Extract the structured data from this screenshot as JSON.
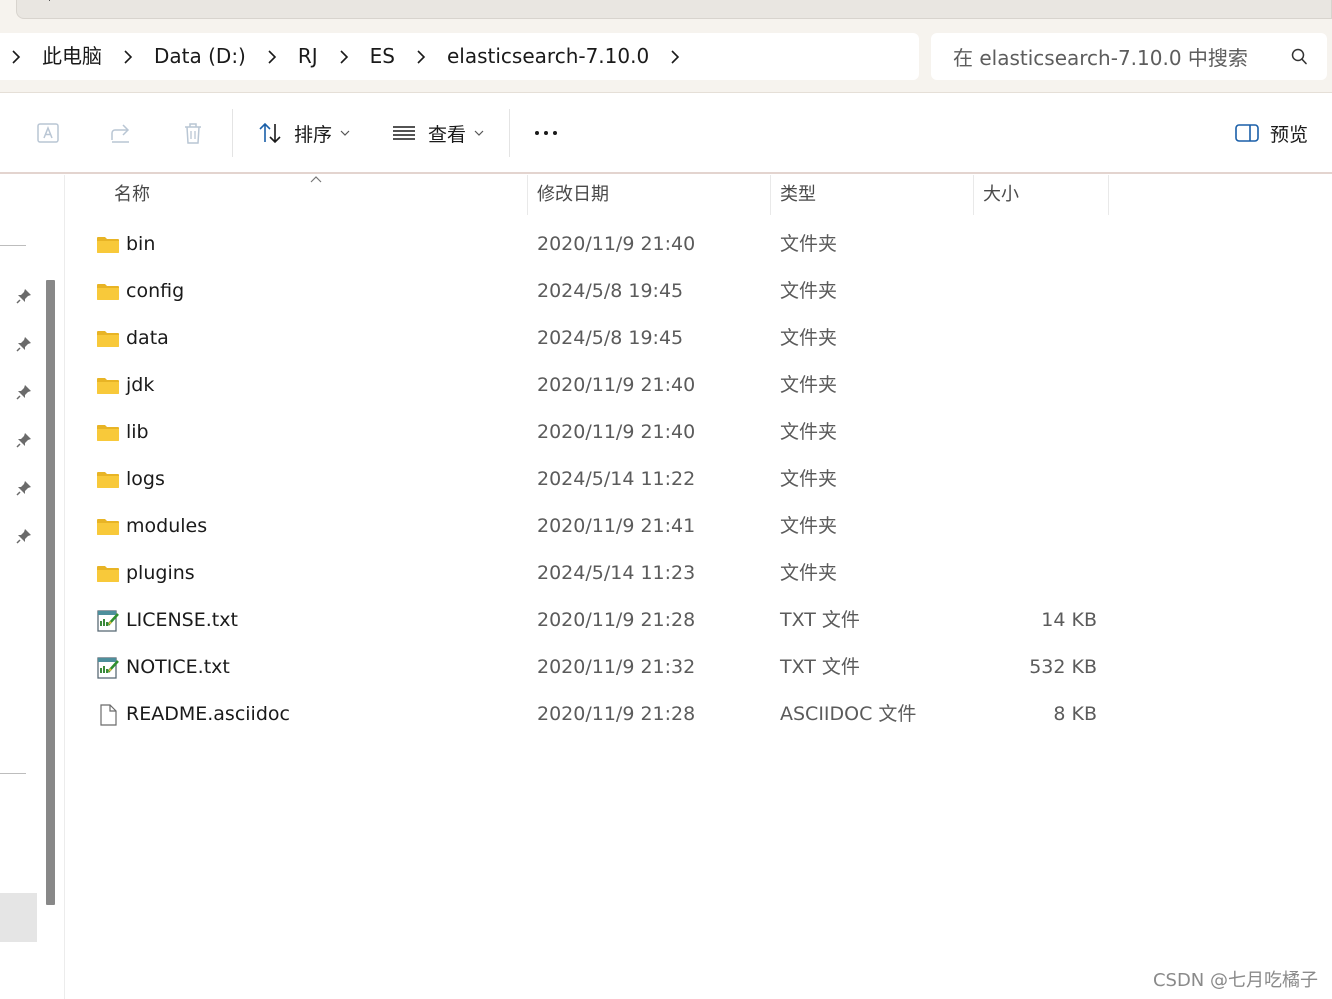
{
  "breadcrumb": {
    "items": [
      {
        "label": "此电脑"
      },
      {
        "label": "Data (D:)"
      },
      {
        "label": "RJ"
      },
      {
        "label": "ES"
      },
      {
        "label": "elasticsearch-7.10.0"
      }
    ]
  },
  "search": {
    "placeholder": "在 elasticsearch-7.10.0 中搜索"
  },
  "toolbar": {
    "sort_label": "排序",
    "view_label": "查看",
    "preview_label": "预览"
  },
  "columns": {
    "name": "名称",
    "modified": "修改日期",
    "type": "类型",
    "size": "大小"
  },
  "files": [
    {
      "name": "bin",
      "modified": "2020/11/9 21:40",
      "type": "文件夹",
      "size": "",
      "icon": "folder-icon"
    },
    {
      "name": "config",
      "modified": "2024/5/8 19:45",
      "type": "文件夹",
      "size": "",
      "icon": "folder-icon"
    },
    {
      "name": "data",
      "modified": "2024/5/8 19:45",
      "type": "文件夹",
      "size": "",
      "icon": "folder-icon"
    },
    {
      "name": "jdk",
      "modified": "2020/11/9 21:40",
      "type": "文件夹",
      "size": "",
      "icon": "folder-icon"
    },
    {
      "name": "lib",
      "modified": "2020/11/9 21:40",
      "type": "文件夹",
      "size": "",
      "icon": "folder-icon"
    },
    {
      "name": "logs",
      "modified": "2024/5/14 11:22",
      "type": "文件夹",
      "size": "",
      "icon": "folder-icon"
    },
    {
      "name": "modules",
      "modified": "2020/11/9 21:41",
      "type": "文件夹",
      "size": "",
      "icon": "folder-icon"
    },
    {
      "name": "plugins",
      "modified": "2024/5/14 11:23",
      "type": "文件夹",
      "size": "",
      "icon": "folder-icon"
    },
    {
      "name": "LICENSE.txt",
      "modified": "2020/11/9 21:28",
      "type": "TXT 文件",
      "size": "14 KB",
      "icon": "text-file-icon"
    },
    {
      "name": "NOTICE.txt",
      "modified": "2020/11/9 21:32",
      "type": "TXT 文件",
      "size": "532 KB",
      "icon": "text-file-icon"
    },
    {
      "name": "README.asciidoc",
      "modified": "2020/11/9 21:28",
      "type": "ASCIIDOC 文件",
      "size": "8 KB",
      "icon": "blank-file-icon"
    }
  ],
  "watermark": "CSDN @七月吃橘子",
  "colors": {
    "folder": "#f8c93a",
    "accent": "#1a73c8",
    "chrome": "#f6f3ee"
  }
}
